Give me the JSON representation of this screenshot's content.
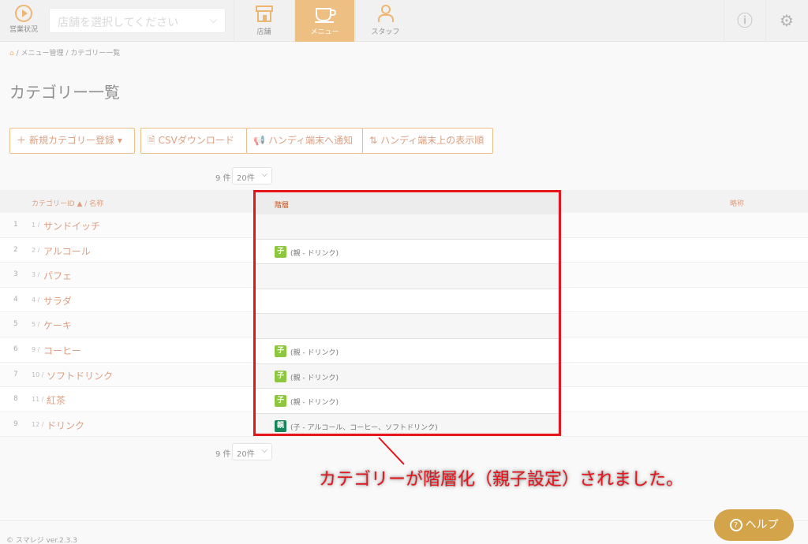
{
  "header": {
    "status_label": "営業状況",
    "store_placeholder": "店舗を選択してください",
    "tabs": [
      {
        "label": "店舗",
        "icon": "store-icon"
      },
      {
        "label": "メニュー",
        "icon": "menu-icon"
      },
      {
        "label": "スタッフ",
        "icon": "staff-icon"
      }
    ],
    "active_tab": "メニュー",
    "info_icon": "info-icon",
    "settings_icon": "gear-icon",
    "accent_color": "#e08a1e"
  },
  "breadcrumb": {
    "items": [
      "メニュー管理",
      "カテゴリー一覧"
    ]
  },
  "page_title": "カテゴリー一覧",
  "toolbar": {
    "new_category": "新規カテゴリー登録",
    "csv_download": "CSVダウンロード",
    "notify_handy": "ハンディ端末へ通知",
    "handy_order": "ハンディ端末上の表示順"
  },
  "pager": {
    "count": "9 件",
    "per_page": "20件"
  },
  "table": {
    "headers": {
      "id_name": "カテゴリーID ▲ / 名称",
      "hierarchy": "階層",
      "abbr": "略称"
    },
    "rows": [
      {
        "num": "1",
        "id": "1 /",
        "name": "サンドイッチ"
      },
      {
        "num": "2",
        "id": "2 /",
        "name": "アルコール"
      },
      {
        "num": "3",
        "id": "3 /",
        "name": "パフェ"
      },
      {
        "num": "4",
        "id": "4 /",
        "name": "サラダ"
      },
      {
        "num": "5",
        "id": "5 /",
        "name": "ケーキ"
      },
      {
        "num": "6",
        "id": "9 /",
        "name": "コーヒー"
      },
      {
        "num": "7",
        "id": "10 /",
        "name": "ソフトドリンク"
      },
      {
        "num": "8",
        "id": "11 /",
        "name": "紅茶"
      },
      {
        "num": "9",
        "id": "12 /",
        "name": "ドリンク"
      }
    ]
  },
  "hierarchy": {
    "header": "階層",
    "rows": [
      {
        "badge": "",
        "text": ""
      },
      {
        "badge": "子",
        "type": "child",
        "text": "(親 - ドリンク)"
      },
      {
        "badge": "",
        "text": ""
      },
      {
        "badge": "",
        "text": ""
      },
      {
        "badge": "",
        "text": ""
      },
      {
        "badge": "子",
        "type": "child",
        "text": "(親 - ドリンク)"
      },
      {
        "badge": "子",
        "type": "child",
        "text": "(親 - ドリンク)"
      },
      {
        "badge": "子",
        "type": "child",
        "text": "(親 - ドリンク)"
      },
      {
        "badge": "親",
        "type": "parent",
        "text": "(子 - アルコール、コーヒー、ソフトドリンク)"
      }
    ]
  },
  "callout": "カテゴリーが階層化（親子設定）されました。",
  "footer": {
    "copyright": "© スマレジ ver.2.3.3",
    "help": "ヘルプ"
  }
}
